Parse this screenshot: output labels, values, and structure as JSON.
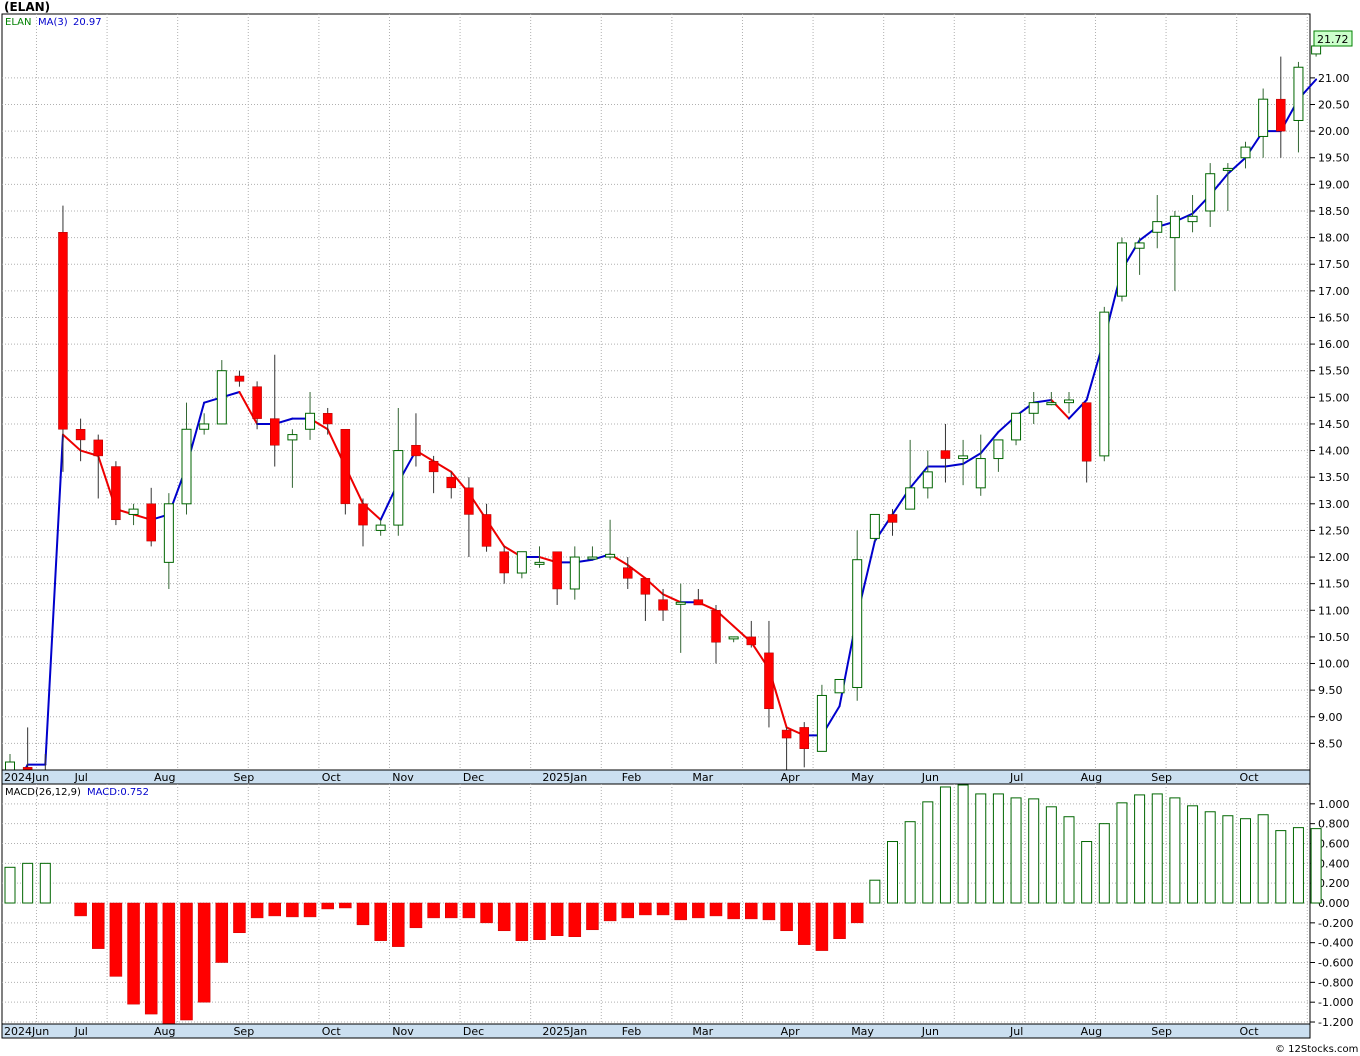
{
  "header": {
    "title": "(ELAN)"
  },
  "price_panel": {
    "legend": {
      "symbol": "ELAN",
      "ma_label": "MA(3)",
      "ma_value": "20.97"
    },
    "last_price_label": "21.72",
    "colors": {
      "up": "#00aa00",
      "down": "#ff0000",
      "ma_up": "#0000cc",
      "ma_down": "#ee0000",
      "frame": "#000000",
      "axis_band": "#cbdff0"
    }
  },
  "macd_panel": {
    "legend": {
      "label": "MACD(26,12,9)",
      "value_label": "MACD:0.752"
    }
  },
  "month_labels": [
    "2024Jun",
    "Jul",
    "Aug",
    "Sep",
    "Oct",
    "Nov",
    "Dec",
    "2025Jan",
    "Feb",
    "Mar",
    "Apr",
    "May",
    "Jun",
    "Jul",
    "Aug",
    "Sep",
    "Oct"
  ],
  "footer": {
    "credit": "© 12Stocks.com"
  },
  "chart_data": [
    {
      "type": "candlestick",
      "title": "(ELAN)",
      "period": "weekly",
      "y_ticks": [
        "8.50",
        "9.00",
        "9.50",
        "10.00",
        "10.50",
        "11.00",
        "11.50",
        "12.00",
        "12.50",
        "13.00",
        "13.50",
        "14.00",
        "14.50",
        "15.00",
        "15.50",
        "16.00",
        "16.50",
        "17.00",
        "17.50",
        "18.00",
        "18.50",
        "19.00",
        "19.50",
        "20.00",
        "20.50",
        "21.00"
      ],
      "ylim": [
        8.0,
        22.2
      ],
      "candles": [
        {
          "o": 7.95,
          "h": 8.3,
          "l": 7.7,
          "c": 8.15
        },
        {
          "o": 8.05,
          "h": 8.8,
          "l": 7.9,
          "c": 8.0
        },
        {
          "o": 8.0,
          "h": 8.3,
          "l": 7.85,
          "c": 7.95
        },
        {
          "o": 18.1,
          "h": 18.6,
          "l": 13.6,
          "c": 14.4
        },
        {
          "o": 14.4,
          "h": 14.6,
          "l": 13.8,
          "c": 14.2
        },
        {
          "o": 14.2,
          "h": 14.3,
          "l": 13.1,
          "c": 13.9
        },
        {
          "o": 13.7,
          "h": 13.8,
          "l": 12.6,
          "c": 12.7
        },
        {
          "o": 12.8,
          "h": 13.0,
          "l": 12.6,
          "c": 12.9
        },
        {
          "o": 13.0,
          "h": 13.3,
          "l": 12.2,
          "c": 12.3
        },
        {
          "o": 11.9,
          "h": 13.2,
          "l": 11.4,
          "c": 13.0
        },
        {
          "o": 13.0,
          "h": 14.9,
          "l": 12.8,
          "c": 14.4
        },
        {
          "o": 14.4,
          "h": 14.7,
          "l": 14.3,
          "c": 14.5
        },
        {
          "o": 14.5,
          "h": 15.7,
          "l": 14.5,
          "c": 15.5
        },
        {
          "o": 15.4,
          "h": 15.5,
          "l": 15.2,
          "c": 15.3
        },
        {
          "o": 15.2,
          "h": 15.3,
          "l": 14.4,
          "c": 14.6
        },
        {
          "o": 14.6,
          "h": 15.8,
          "l": 13.7,
          "c": 14.1
        },
        {
          "o": 14.2,
          "h": 14.4,
          "l": 13.3,
          "c": 14.3
        },
        {
          "o": 14.4,
          "h": 15.1,
          "l": 14.2,
          "c": 14.7
        },
        {
          "o": 14.7,
          "h": 14.8,
          "l": 14.3,
          "c": 14.5
        },
        {
          "o": 14.4,
          "h": 14.4,
          "l": 12.8,
          "c": 13.0
        },
        {
          "o": 13.0,
          "h": 13.1,
          "l": 12.2,
          "c": 12.6
        },
        {
          "o": 12.5,
          "h": 12.7,
          "l": 12.4,
          "c": 12.6
        },
        {
          "o": 12.6,
          "h": 14.8,
          "l": 12.4,
          "c": 14.0
        },
        {
          "o": 14.1,
          "h": 14.7,
          "l": 13.7,
          "c": 13.9
        },
        {
          "o": 13.8,
          "h": 13.9,
          "l": 13.2,
          "c": 13.6
        },
        {
          "o": 13.5,
          "h": 13.6,
          "l": 13.1,
          "c": 13.3
        },
        {
          "o": 13.3,
          "h": 13.5,
          "l": 12.0,
          "c": 12.8
        },
        {
          "o": 12.8,
          "h": 13.0,
          "l": 12.1,
          "c": 12.2
        },
        {
          "o": 12.1,
          "h": 12.2,
          "l": 11.5,
          "c": 11.7
        },
        {
          "o": 11.7,
          "h": 12.1,
          "l": 11.6,
          "c": 12.1
        },
        {
          "o": 11.9,
          "h": 12.2,
          "l": 11.8,
          "c": 11.9
        },
        {
          "o": 12.1,
          "h": 12.1,
          "l": 11.1,
          "c": 11.4
        },
        {
          "o": 11.4,
          "h": 12.2,
          "l": 11.2,
          "c": 12.0
        },
        {
          "o": 12.0,
          "h": 12.2,
          "l": 11.95,
          "c": 12.0
        },
        {
          "o": 12.0,
          "h": 12.7,
          "l": 11.95,
          "c": 12.05
        },
        {
          "o": 11.8,
          "h": 12.0,
          "l": 11.4,
          "c": 11.6
        },
        {
          "o": 11.6,
          "h": 11.6,
          "l": 10.8,
          "c": 11.3
        },
        {
          "o": 11.2,
          "h": 11.4,
          "l": 10.8,
          "c": 11.0
        },
        {
          "o": 11.15,
          "h": 11.5,
          "l": 10.2,
          "c": 11.15
        },
        {
          "o": 11.2,
          "h": 11.4,
          "l": 11.1,
          "c": 11.1
        },
        {
          "o": 11.0,
          "h": 11.1,
          "l": 10.0,
          "c": 10.4
        },
        {
          "o": 10.5,
          "h": 10.5,
          "l": 10.4,
          "c": 10.5
        },
        {
          "o": 10.5,
          "h": 10.8,
          "l": 10.3,
          "c": 10.35
        },
        {
          "o": 10.2,
          "h": 10.8,
          "l": 8.8,
          "c": 9.15
        },
        {
          "o": 8.75,
          "h": 8.8,
          "l": 7.9,
          "c": 8.6
        },
        {
          "o": 8.8,
          "h": 8.9,
          "l": 8.05,
          "c": 8.4
        },
        {
          "o": 8.35,
          "h": 9.6,
          "l": 8.35,
          "c": 9.4
        },
        {
          "o": 9.45,
          "h": 9.7,
          "l": 9.45,
          "c": 9.7
        },
        {
          "o": 9.55,
          "h": 12.5,
          "l": 9.3,
          "c": 11.95
        },
        {
          "o": 12.35,
          "h": 12.8,
          "l": 12.3,
          "c": 12.8
        },
        {
          "o": 12.8,
          "h": 12.9,
          "l": 12.4,
          "c": 12.65
        },
        {
          "o": 12.9,
          "h": 14.2,
          "l": 12.9,
          "c": 13.3
        },
        {
          "o": 13.3,
          "h": 14.0,
          "l": 13.1,
          "c": 13.6
        },
        {
          "o": 14.0,
          "h": 14.5,
          "l": 13.4,
          "c": 13.85
        },
        {
          "o": 13.85,
          "h": 14.2,
          "l": 13.35,
          "c": 13.9
        },
        {
          "o": 13.3,
          "h": 14.3,
          "l": 13.15,
          "c": 13.85
        },
        {
          "o": 13.85,
          "h": 14.1,
          "l": 13.6,
          "c": 14.2
        },
        {
          "o": 14.2,
          "h": 14.7,
          "l": 14.1,
          "c": 14.7
        },
        {
          "o": 14.7,
          "h": 15.1,
          "l": 14.5,
          "c": 14.9
        },
        {
          "o": 14.9,
          "h": 15.1,
          "l": 14.85,
          "c": 14.9
        },
        {
          "o": 14.9,
          "h": 15.1,
          "l": 14.7,
          "c": 14.95
        },
        {
          "o": 14.9,
          "h": 14.9,
          "l": 13.4,
          "c": 13.8
        },
        {
          "o": 13.9,
          "h": 16.7,
          "l": 13.8,
          "c": 16.6
        },
        {
          "o": 16.9,
          "h": 18.0,
          "l": 16.8,
          "c": 17.9
        },
        {
          "o": 17.8,
          "h": 18.0,
          "l": 17.3,
          "c": 17.9
        },
        {
          "o": 18.1,
          "h": 18.8,
          "l": 17.8,
          "c": 18.3
        },
        {
          "o": 18.0,
          "h": 18.5,
          "l": 17.0,
          "c": 18.4
        },
        {
          "o": 18.3,
          "h": 18.8,
          "l": 18.1,
          "c": 18.4
        },
        {
          "o": 18.5,
          "h": 19.4,
          "l": 18.2,
          "c": 19.2
        },
        {
          "o": 19.3,
          "h": 19.4,
          "l": 18.5,
          "c": 19.3
        },
        {
          "o": 19.5,
          "h": 19.8,
          "l": 19.3,
          "c": 19.7
        },
        {
          "o": 19.9,
          "h": 20.8,
          "l": 19.5,
          "c": 20.6
        },
        {
          "o": 20.6,
          "h": 21.4,
          "l": 19.5,
          "c": 20.0
        },
        {
          "o": 20.2,
          "h": 21.3,
          "l": 19.6,
          "c": 21.2
        },
        {
          "o": 21.45,
          "h": 21.65,
          "l": 21.4,
          "c": 21.6
        }
      ],
      "moving_average": {
        "name": "MA(3)",
        "values": [
          7.5,
          8.1,
          8.1,
          14.3,
          14.0,
          13.9,
          12.9,
          12.8,
          12.7,
          12.8,
          13.7,
          14.9,
          15.0,
          15.1,
          14.5,
          14.5,
          14.6,
          14.6,
          14.4,
          13.7,
          13.0,
          12.7,
          13.4,
          14.0,
          13.8,
          13.6,
          13.2,
          12.7,
          12.2,
          12.0,
          12.0,
          11.9,
          11.9,
          11.95,
          12.05,
          11.85,
          11.6,
          11.3,
          11.15,
          11.15,
          11.0,
          10.7,
          10.4,
          9.9,
          8.8,
          8.65,
          8.65,
          9.2,
          10.9,
          12.3,
          12.8,
          13.3,
          13.7,
          13.7,
          13.75,
          13.95,
          14.35,
          14.65,
          14.9,
          14.95,
          14.6,
          14.95,
          16.1,
          17.4,
          17.95,
          18.2,
          18.3,
          18.45,
          18.8,
          19.2,
          19.5,
          20.0,
          20.0,
          20.6,
          20.97
        ],
        "up_color": "#0000cc",
        "down_color": "#ee0000"
      }
    },
    {
      "type": "bar",
      "title": "MACD(26,12,9)",
      "y_ticks": [
        "1.000",
        "0.800",
        "0.600",
        "0.400",
        "0.200",
        "0.000",
        "-0.200",
        "-0.400",
        "-0.600",
        "-0.800",
        "-1.000",
        "-1.200"
      ],
      "ylim": [
        -1.22,
        1.2
      ],
      "values": [
        0.36,
        0.4,
        0.4,
        0.0,
        -0.13,
        -0.46,
        -0.74,
        -1.02,
        -1.12,
        -1.22,
        -1.18,
        -1.0,
        -0.6,
        -0.3,
        -0.15,
        -0.13,
        -0.14,
        -0.14,
        -0.06,
        -0.05,
        -0.22,
        -0.38,
        -0.44,
        -0.25,
        -0.15,
        -0.15,
        -0.15,
        -0.2,
        -0.28,
        -0.38,
        -0.37,
        -0.33,
        -0.34,
        -0.27,
        -0.18,
        -0.15,
        -0.12,
        -0.12,
        -0.17,
        -0.15,
        -0.13,
        -0.16,
        -0.16,
        -0.17,
        -0.28,
        -0.42,
        -0.48,
        -0.36,
        -0.2,
        0.23,
        0.62,
        0.82,
        1.02,
        1.17,
        1.19,
        1.1,
        1.1,
        1.06,
        1.05,
        0.97,
        0.87,
        0.62,
        0.8,
        1.01,
        1.09,
        1.1,
        1.06,
        0.98,
        0.92,
        0.88,
        0.85,
        0.89,
        0.73,
        0.76,
        0.75
      ]
    }
  ]
}
